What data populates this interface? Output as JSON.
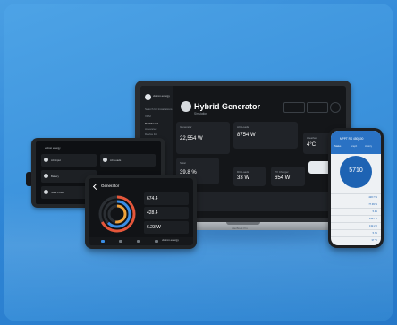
{
  "laptop": {
    "brand": "victron energy",
    "title": "Hybrid Generator",
    "subtitle": "Simulation",
    "menu": [
      "Search for Installations",
      "VRM",
      "Dashboard",
      "Advanced",
      "Device list",
      "Settings"
    ],
    "tiles": [
      {
        "label": "Generator",
        "value": "22,554 W"
      },
      {
        "label": "AC Loads",
        "value": "8754 W"
      },
      {
        "label": "Weather",
        "value": "4°C"
      },
      {
        "label": "Solar",
        "value": "39.8 %"
      },
      {
        "label": "DC Loads",
        "value": "33 W"
      },
      {
        "label": "PV Charger",
        "value": "654 W"
      }
    ],
    "base_brand": "MacBook Pro"
  },
  "plotter": {
    "brand": "victron energy",
    "rows": [
      {
        "label": "AC Input",
        "value": ""
      },
      {
        "label": "AC Loads",
        "value": ""
      },
      {
        "label": "Battery",
        "value": ""
      },
      {
        "label": "Inverter/Charger",
        "value": ""
      },
      {
        "label": "Solar Power",
        "value": ""
      }
    ]
  },
  "tablet": {
    "title": "Generator",
    "values": [
      {
        "label": "",
        "value": "674.4"
      },
      {
        "label": "",
        "value": "428.4"
      },
      {
        "label": "",
        "value": "6.23 W"
      }
    ],
    "brand": "victron energy"
  },
  "phone": {
    "title": "MPPT RS 450|100",
    "tabs": [
      "Status",
      "Graph",
      "History"
    ],
    "gauge_value": "5710",
    "rows": [
      {
        "k": "",
        "v": "428.7 W"
      },
      {
        "k": "",
        "v": "77.99 W"
      },
      {
        "k": "",
        "v": "5.4A"
      },
      {
        "k": "",
        "v": "144.7 V"
      },
      {
        "k": "",
        "v": "132.2 V"
      },
      {
        "k": "",
        "v": "5.7A"
      },
      {
        "k": "",
        "v": "37 °C"
      }
    ]
  }
}
